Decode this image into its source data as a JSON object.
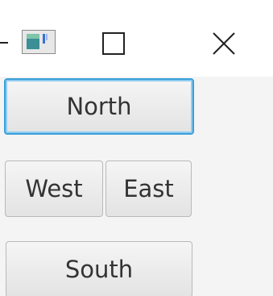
{
  "window": {
    "title_icon": "java-app-icon",
    "controls": {
      "maximize_icon": "maximize-icon",
      "close_icon": "close-icon"
    }
  },
  "buttons": {
    "north": "North",
    "west": "West",
    "east": "East",
    "south": "South"
  },
  "colors": {
    "focus_ring": "#3a9fd9",
    "button_border": "#b9b9b9",
    "content_bg": "#f4f4f4"
  }
}
